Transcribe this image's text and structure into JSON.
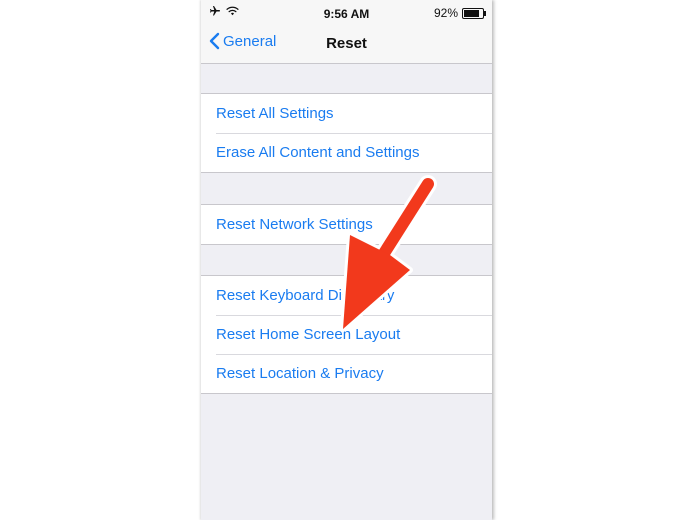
{
  "status": {
    "time": "9:56 AM",
    "battery": "92%",
    "battery_level": 0.92
  },
  "nav": {
    "back_label": "General",
    "title": "Reset"
  },
  "groups": [
    {
      "items": [
        {
          "label": "Reset All Settings"
        },
        {
          "label": "Erase All Content and Settings"
        }
      ]
    },
    {
      "items": [
        {
          "label": "Reset Network Settings"
        }
      ]
    },
    {
      "items": [
        {
          "label": "Reset Keyboard Dictionary"
        },
        {
          "label": "Reset Home Screen Layout"
        },
        {
          "label": "Reset Location & Privacy"
        }
      ]
    }
  ],
  "colors": {
    "link": "#1a7cf0",
    "background": "#efeff4",
    "arrow": "#f2391c"
  },
  "icons": {
    "airplane": "airplane-icon",
    "wifi": "wifi-icon",
    "battery": "battery-icon",
    "back": "chevron-left-icon"
  }
}
